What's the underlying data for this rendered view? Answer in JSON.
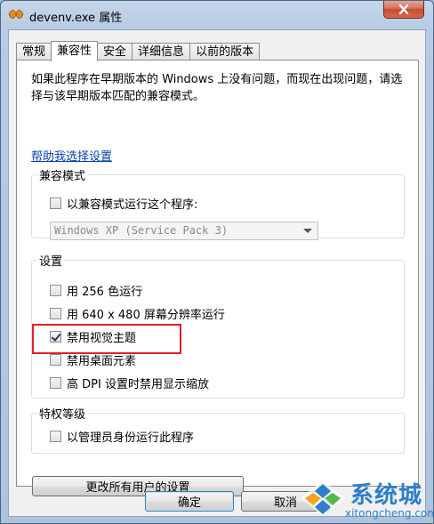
{
  "window": {
    "title": "devenv.exe 属性"
  },
  "tabs": [
    {
      "label": "常规",
      "active": false
    },
    {
      "label": "兼容性",
      "active": true
    },
    {
      "label": "安全",
      "active": false
    },
    {
      "label": "详细信息",
      "active": false
    },
    {
      "label": "以前的版本",
      "active": false
    }
  ],
  "intro_text": "如果此程序在早期版本的 Windows 上没有问题，而现在出现问题，请选择与该早期版本匹配的兼容模式。",
  "help_link": "帮助我选择设置",
  "compat_mode": {
    "group_label": "兼容模式",
    "checkbox_label": "以兼容模式运行这个程序:",
    "checked": false,
    "select_value": "Windows XP (Service Pack 3)"
  },
  "settings": {
    "group_label": "设置",
    "options": [
      {
        "label": "用 256 色运行",
        "checked": false
      },
      {
        "label": "用 640 x 480 屏幕分辨率运行",
        "checked": false
      },
      {
        "label": "禁用视觉主题",
        "checked": true
      },
      {
        "label": "禁用桌面元素",
        "checked": false
      },
      {
        "label": "高 DPI 设置时禁用显示缩放",
        "checked": false
      }
    ]
  },
  "privilege": {
    "group_label": "特权等级",
    "checkbox_label": "以管理员身份运行此程序",
    "checked": false
  },
  "buttons": {
    "change_all_users": "更改所有用户的设置",
    "ok": "确定",
    "cancel": "取消"
  },
  "watermark": {
    "text": "系统城",
    "sub": "xitongcheng.com"
  },
  "colors": {
    "highlight_box": "#e0202a",
    "link": "#0645ad",
    "watermark": "#2d7fc8"
  }
}
